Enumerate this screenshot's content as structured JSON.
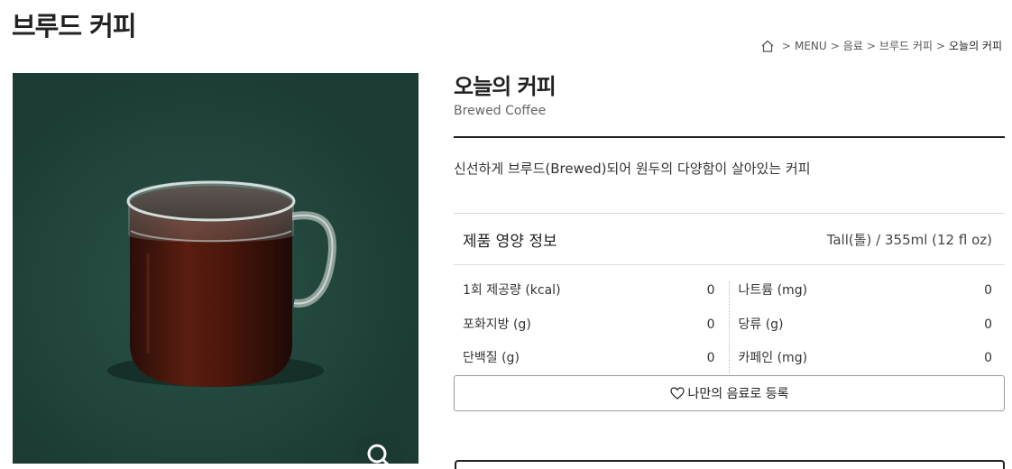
{
  "page": {
    "title": "브루드 커피"
  },
  "breadcrumb": {
    "home_icon": "home-icon",
    "items": [
      "MENU",
      "음료",
      "브루드 커피",
      "오늘의 커피"
    ]
  },
  "product": {
    "name": "오늘의 커피",
    "name_en": "Brewed Coffee",
    "description": "신선하게 브루드(Brewed)되어 원두의 다양함이 살아있는 커피",
    "image_background": "#1e4239",
    "zoom_icon": "search-icon"
  },
  "nutrition": {
    "title": "제품 영양 정보",
    "serving": "Tall(톨) / 355ml (12 fl oz)",
    "left": [
      {
        "label": "1회 제공량 (kcal)",
        "value": "0"
      },
      {
        "label": "포화지방 (g)",
        "value": "0"
      },
      {
        "label": "단백질 (g)",
        "value": "0"
      }
    ],
    "right": [
      {
        "label": "나트륨 (mg)",
        "value": "0"
      },
      {
        "label": "당류 (g)",
        "value": "0"
      },
      {
        "label": "카페인 (mg)",
        "value": "0"
      }
    ]
  },
  "actions": {
    "register_label": "나만의 음료로 등록",
    "register_icon": "heart-icon"
  }
}
